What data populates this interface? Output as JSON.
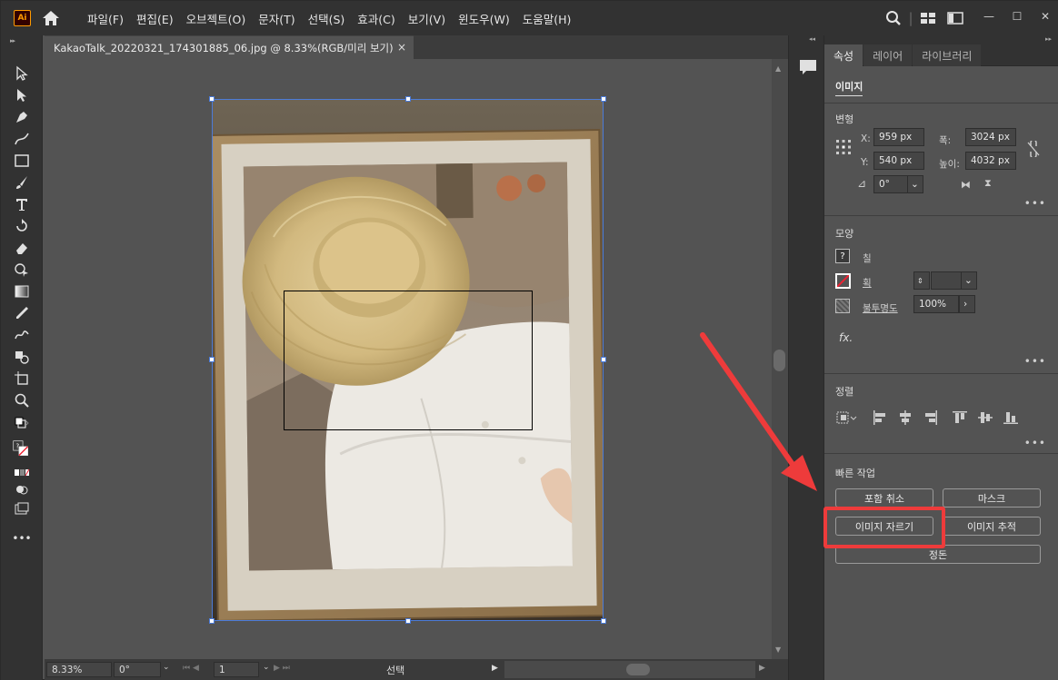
{
  "app": {
    "logo_text": "Ai",
    "menu": [
      "파일(F)",
      "편집(E)",
      "오브젝트(O)",
      "문자(T)",
      "선택(S)",
      "효과(C)",
      "보기(V)",
      "윈도우(W)",
      "도움말(H)"
    ]
  },
  "document": {
    "tab_title": "KakaoTalk_20220321_174301885_06.jpg @ 8.33%(RGB/미리 보기)",
    "close_glyph": "×"
  },
  "status": {
    "zoom": "8.33%",
    "rotation": "0°",
    "artboard": "1",
    "mode": "선택"
  },
  "panel": {
    "tabs": [
      "속성",
      "레이어",
      "라이브러리"
    ],
    "object_type": "이미지",
    "transform": {
      "title": "변형",
      "x_label": "X:",
      "x_value": "959 px",
      "y_label": "Y:",
      "y_value": "540 px",
      "w_label": "폭:",
      "w_value": "3024 px",
      "h_label": "높이:",
      "h_value": "4032 px",
      "angle_value": "0°"
    },
    "appearance": {
      "title": "모양",
      "fill_label": "칠",
      "stroke_label": "획",
      "opacity_label": "불투명도",
      "opacity_value": "100%",
      "fx_label": "fx."
    },
    "align": {
      "title": "정렬"
    },
    "quick_actions": {
      "title": "빠른 작업",
      "unembed": "포함 취소",
      "mask": "마스크",
      "crop": "이미지 자르기",
      "trace": "이미지 추적",
      "arrange": "정돈"
    },
    "more_glyph": "•••"
  },
  "colors": {
    "highlight": "#ee3b3b",
    "selection": "#4b7bd8",
    "ai_logo": "#ff9a00"
  }
}
